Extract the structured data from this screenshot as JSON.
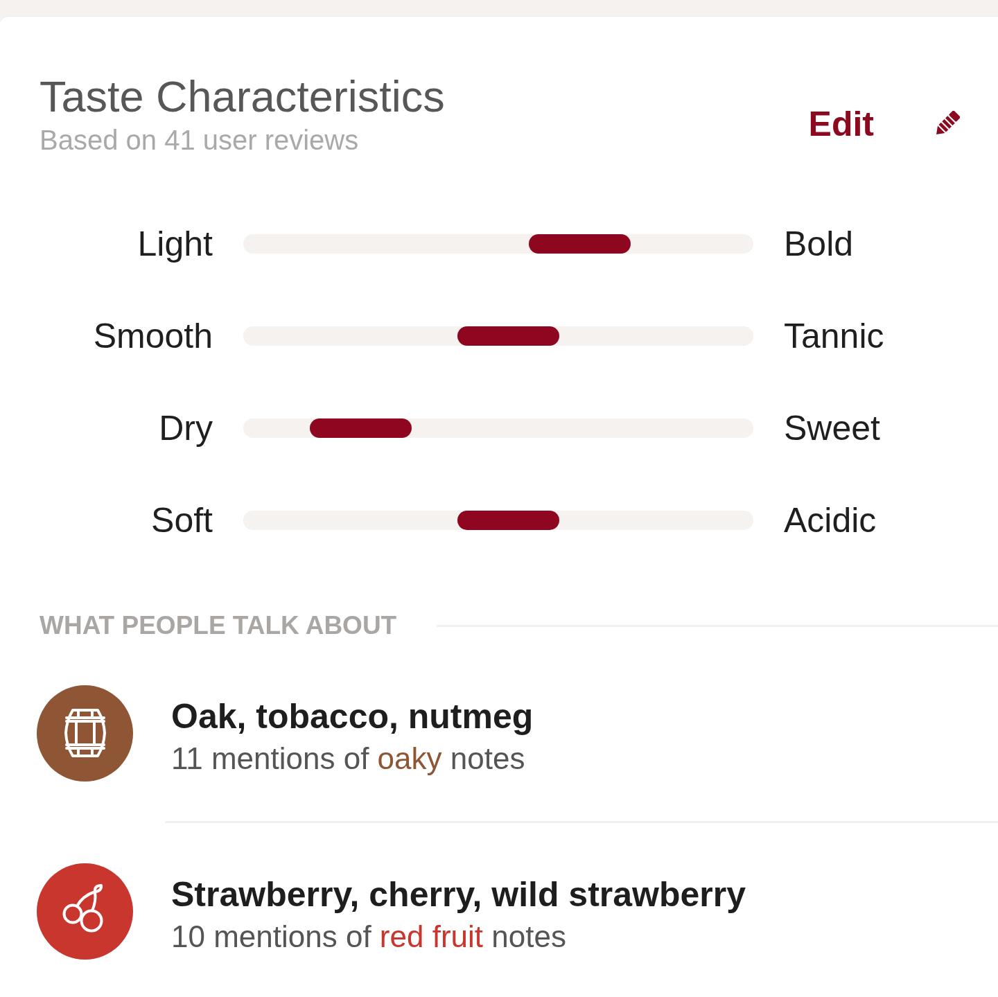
{
  "header": {
    "title": "Taste Characteristics",
    "subtitle": "Based on 41 user reviews",
    "edit_label": "Edit"
  },
  "scales": [
    {
      "left": "Light",
      "right": "Bold",
      "level": 0.66
    },
    {
      "left": "Smooth",
      "right": "Tannic",
      "level": 0.52
    },
    {
      "left": "Dry",
      "right": "Sweet",
      "level": 0.23
    },
    {
      "left": "Soft",
      "right": "Acidic",
      "level": 0.52
    }
  ],
  "talk_about": {
    "heading": "WHAT PEOPLE TALK ABOUT",
    "notes": [
      {
        "kind": "oak",
        "color": "#8e5635",
        "title": "Oak, tobacco, nutmeg",
        "mentions": {
          "before": "11 mentions of",
          "note": "oaky",
          "after": "notes"
        }
      },
      {
        "kind": "red_fruit",
        "color": "#c9362d",
        "title": "Strawberry, cherry, wild strawberry",
        "mentions": {
          "before": "10 mentions of",
          "note": "red fruit",
          "after": "notes"
        }
      }
    ]
  }
}
